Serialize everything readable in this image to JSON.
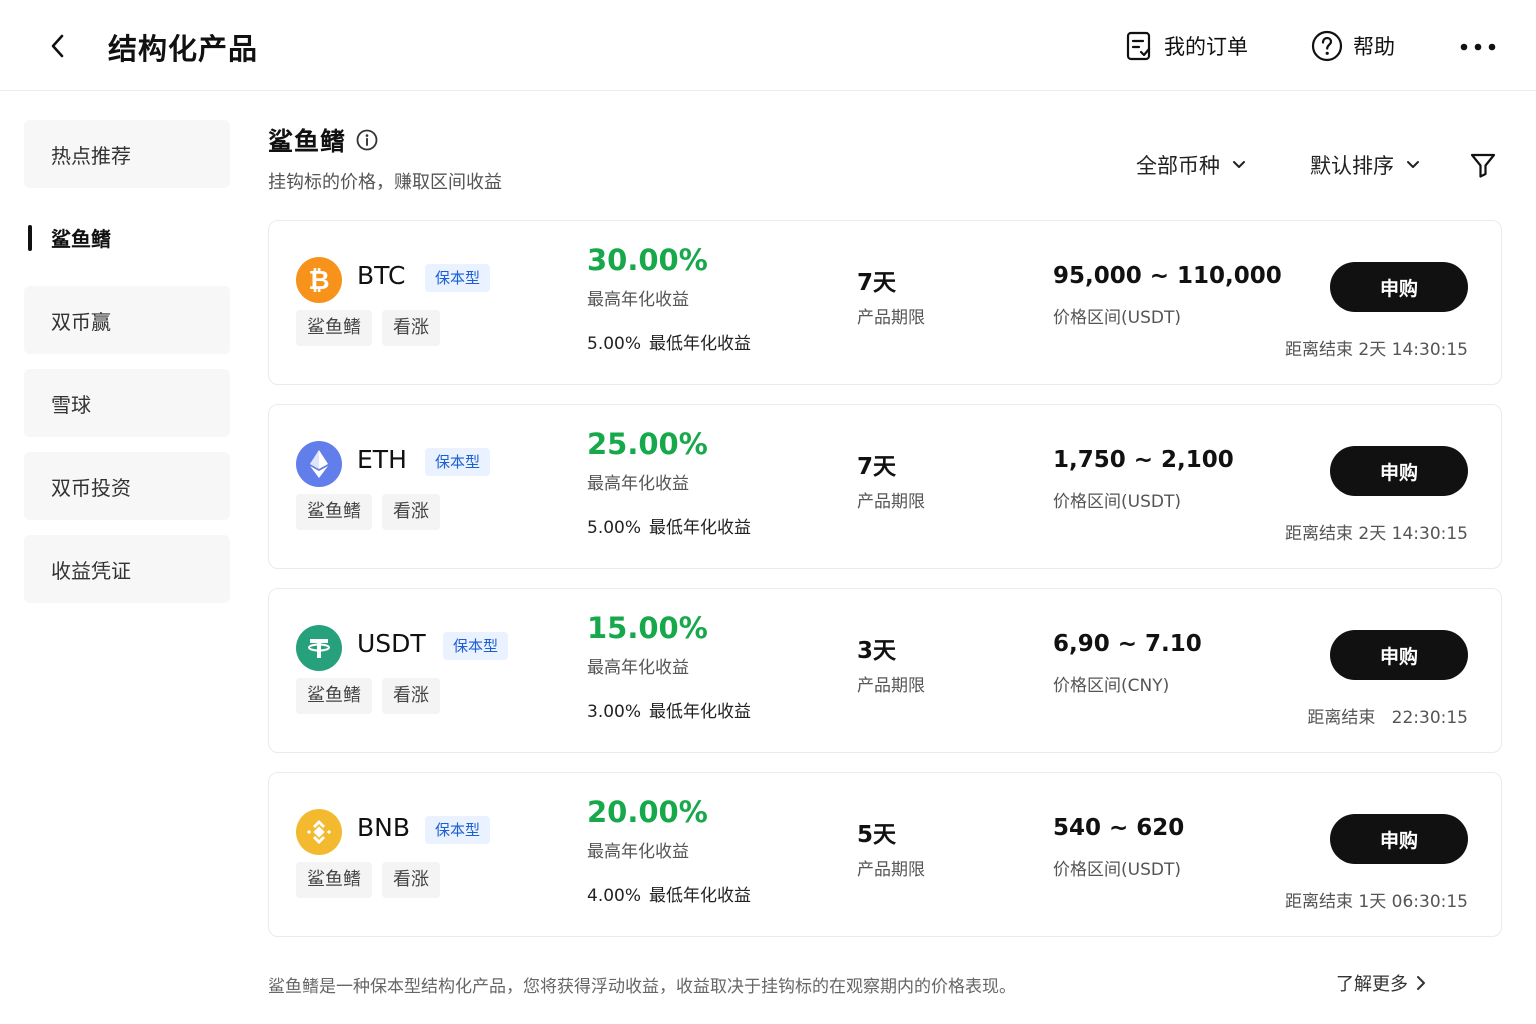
{
  "header": {
    "title": "结构化产品",
    "orders_label": "我的订单",
    "help_label": "帮助"
  },
  "sidebar": {
    "items": [
      {
        "label": "热点推荐",
        "active": false
      },
      {
        "label": "鲨鱼鳍",
        "active": true
      },
      {
        "label": "双币赢",
        "active": false
      },
      {
        "label": "雪球",
        "active": false
      },
      {
        "label": "双币投资",
        "active": false
      },
      {
        "label": "收益凭证",
        "active": false
      }
    ]
  },
  "section": {
    "title": "鲨鱼鳍",
    "subtitle": "挂钩标的价格，赚取区间收益"
  },
  "filters": {
    "coins_label": "全部币种",
    "sort_label": "默认排序"
  },
  "labels": {
    "max_apy": "最高年化收益",
    "min_apy": "最低年化收益",
    "term": "产品期限",
    "buy": "申购",
    "countdown_prefix": "距离结束"
  },
  "products": [
    {
      "coin": "BTC",
      "icon": "btc-icon",
      "color": "#f7931a",
      "badge": "保本型",
      "tags": [
        "鲨鱼鳍",
        "看涨"
      ],
      "max_apy": "30.00%",
      "min_apy": "5.00%",
      "term": "7天",
      "range": "95,000 ~ 110,000",
      "range_label": "价格区间(USDT)",
      "countdown": "2天 14:30:15"
    },
    {
      "coin": "ETH",
      "icon": "eth-icon",
      "color": "#627eea",
      "badge": "保本型",
      "tags": [
        "鲨鱼鳍",
        "看涨"
      ],
      "max_apy": "25.00%",
      "min_apy": "5.00%",
      "term": "7天",
      "range": "1,750 ~ 2,100",
      "range_label": "价格区间(USDT)",
      "countdown": "2天 14:30:15"
    },
    {
      "coin": "USDT",
      "icon": "usdt-icon",
      "color": "#26a17b",
      "badge": "保本型",
      "tags": [
        "鲨鱼鳍",
        "看涨"
      ],
      "max_apy": "15.00%",
      "min_apy": "3.00%",
      "term": "3天",
      "range": "6,90 ~ 7.10",
      "range_label": "价格区间(CNY)",
      "countdown": "22:30:15"
    },
    {
      "coin": "BNB",
      "icon": "bnb-icon",
      "color": "#f3ba2f",
      "badge": "保本型",
      "tags": [
        "鲨鱼鳍",
        "看涨"
      ],
      "max_apy": "20.00%",
      "min_apy": "4.00%",
      "term": "5天",
      "range": "540 ~ 620",
      "range_label": "价格区间(USDT)",
      "countdown": "1天 06:30:15"
    }
  ],
  "footer": {
    "note": "鲨鱼鳍是一种保本型结构化产品，您将获得浮动收益，收益取决于挂钩标的在观察期内的价格表现。",
    "learn_more": "了解更多"
  }
}
